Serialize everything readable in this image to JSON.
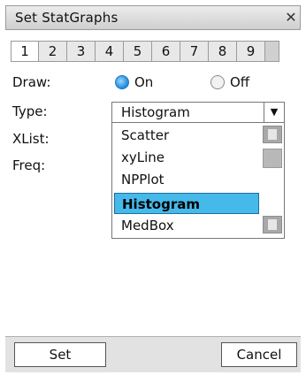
{
  "window": {
    "title": "Set StatGraphs"
  },
  "tabs": [
    "1",
    "2",
    "3",
    "4",
    "5",
    "6",
    "7",
    "8",
    "9"
  ],
  "form": {
    "draw_label": "Draw:",
    "draw_on": "On",
    "draw_off": "Off",
    "type_label": "Type:",
    "type_value": "Histogram",
    "xlist_label": "XList:",
    "freq_label": "Freq:"
  },
  "dropdown": {
    "items": [
      "Scatter",
      "xyLine",
      "NPPlot",
      "Histogram",
      "MedBox"
    ],
    "selected": "Histogram"
  },
  "buttons": {
    "set": "Set",
    "cancel": "Cancel"
  },
  "colors": {
    "highlight": "#45b9ea",
    "radio_selected": "#2a94e0"
  },
  "icons": {
    "close": "close-icon",
    "dropdown": "chevron-down-icon",
    "scroll_up": "scroll-up-icon",
    "scroll_down": "scroll-down-icon"
  }
}
